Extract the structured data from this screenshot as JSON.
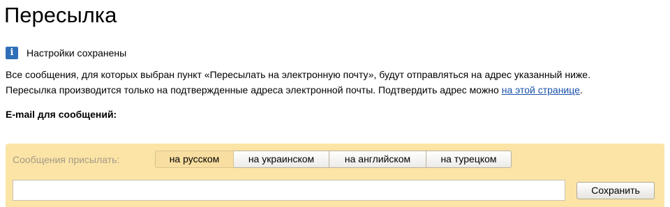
{
  "page": {
    "title": "Пересылка"
  },
  "notice": {
    "icon": "info-icon",
    "icon_glyph": "i",
    "icon_color": "#2f6fb8",
    "text": "Настройки сохранены"
  },
  "description": {
    "line1": "Все сообщения, для которых выбран пункт «Пересылать на электронную почту», будут отправляться на адрес указанный ниже.",
    "line2_prefix": "Пересылка производится только на подтвержденные адреса электронной почты. Подтвердить адрес можно ",
    "link_text": "на этой странице",
    "line2_suffix": "."
  },
  "email_section": {
    "label": "E-mail для сообщений:"
  },
  "form": {
    "panel_color": "#fbe4a6",
    "language_label": "Сообщения присылать:",
    "tabs": [
      {
        "label": "на русском",
        "active": true
      },
      {
        "label": "на украинском",
        "active": false
      },
      {
        "label": "на английском",
        "active": false
      },
      {
        "label": "на турецком",
        "active": false
      }
    ],
    "email_value": "",
    "email_placeholder": "",
    "save_label": "Сохранить"
  }
}
